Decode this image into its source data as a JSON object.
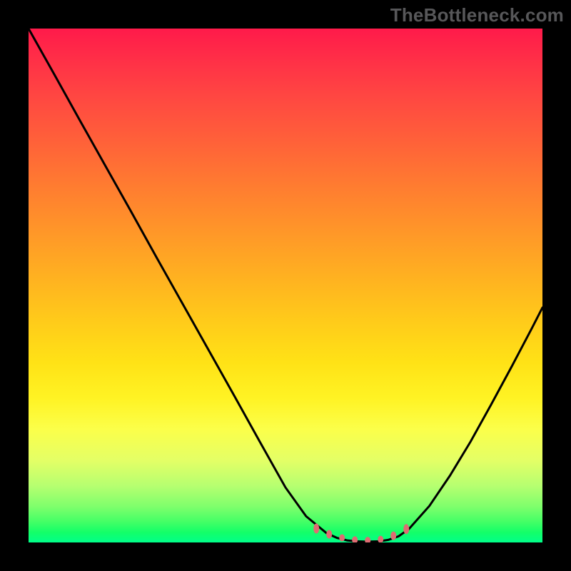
{
  "watermark": "TheBottleneck.com",
  "chart_data": {
    "type": "line",
    "title": "",
    "xlabel": "",
    "ylabel": "",
    "xlim": [
      0,
      100
    ],
    "ylim": [
      0,
      100
    ],
    "series": [
      {
        "name": "curve",
        "x": [
          0,
          5,
          10,
          15,
          20,
          25,
          30,
          35,
          40,
          45,
          50,
          54,
          58,
          60,
          62,
          64,
          66,
          68,
          70,
          72,
          74,
          78,
          82,
          86,
          90,
          94,
          98,
          100
        ],
        "y": [
          100,
          91.1,
          82.1,
          73.2,
          64.3,
          55.3,
          46.4,
          37.5,
          28.6,
          19.6,
          10.7,
          5.1,
          1.8,
          0.9,
          0.4,
          0.2,
          0.15,
          0.2,
          0.5,
          1.2,
          2.6,
          7.1,
          13.0,
          19.6,
          26.8,
          34.2,
          41.8,
          45.7
        ],
        "color": "#000000",
        "width": 3
      }
    ],
    "markers": [
      {
        "x": 56.0,
        "y": 2.7,
        "color": "#de6c72",
        "rx": 4,
        "ry": 7
      },
      {
        "x": 58.5,
        "y": 1.6,
        "color": "#de6c72",
        "rx": 4,
        "ry": 6
      },
      {
        "x": 61.0,
        "y": 0.9,
        "color": "#de6c72",
        "rx": 4,
        "ry": 5
      },
      {
        "x": 63.5,
        "y": 0.5,
        "color": "#de6c72",
        "rx": 4,
        "ry": 5
      },
      {
        "x": 66.0,
        "y": 0.4,
        "color": "#de6c72",
        "rx": 4,
        "ry": 5
      },
      {
        "x": 68.5,
        "y": 0.6,
        "color": "#de6c72",
        "rx": 4,
        "ry": 5
      },
      {
        "x": 71.0,
        "y": 1.3,
        "color": "#de6c72",
        "rx": 4,
        "ry": 6
      },
      {
        "x": 73.5,
        "y": 2.6,
        "color": "#de6c72",
        "rx": 4,
        "ry": 7
      }
    ],
    "gradient": {
      "top": "#ff1a4a",
      "mid": "#fff324",
      "bottom": "#00ff89"
    }
  }
}
